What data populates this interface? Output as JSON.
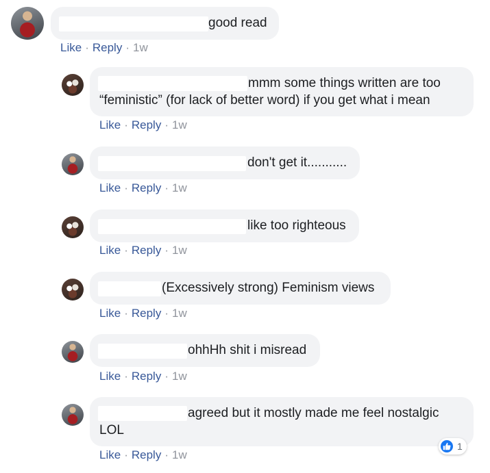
{
  "comments": [
    {
      "text": "good read",
      "time": "1w"
    },
    {
      "text_line1": "mmm some things written are too",
      "text_line2": "“feministic” (for lack of better word) if you get what i mean",
      "time": "1w"
    },
    {
      "text": "don't get it...........",
      "time": "1w"
    },
    {
      "text": "like too righteous",
      "time": "1w"
    },
    {
      "text": "(Excessively strong) Feminism views",
      "time": "1w"
    },
    {
      "text": "ohhHh shit i misread",
      "time": "1w"
    },
    {
      "text_line1": "agreed but it mostly made me feel nostalgic",
      "text_line2": "LOL",
      "time": "1w",
      "reaction_count": "1"
    }
  ],
  "actions": {
    "like": "Like",
    "reply": "Reply",
    "dot": "·"
  }
}
